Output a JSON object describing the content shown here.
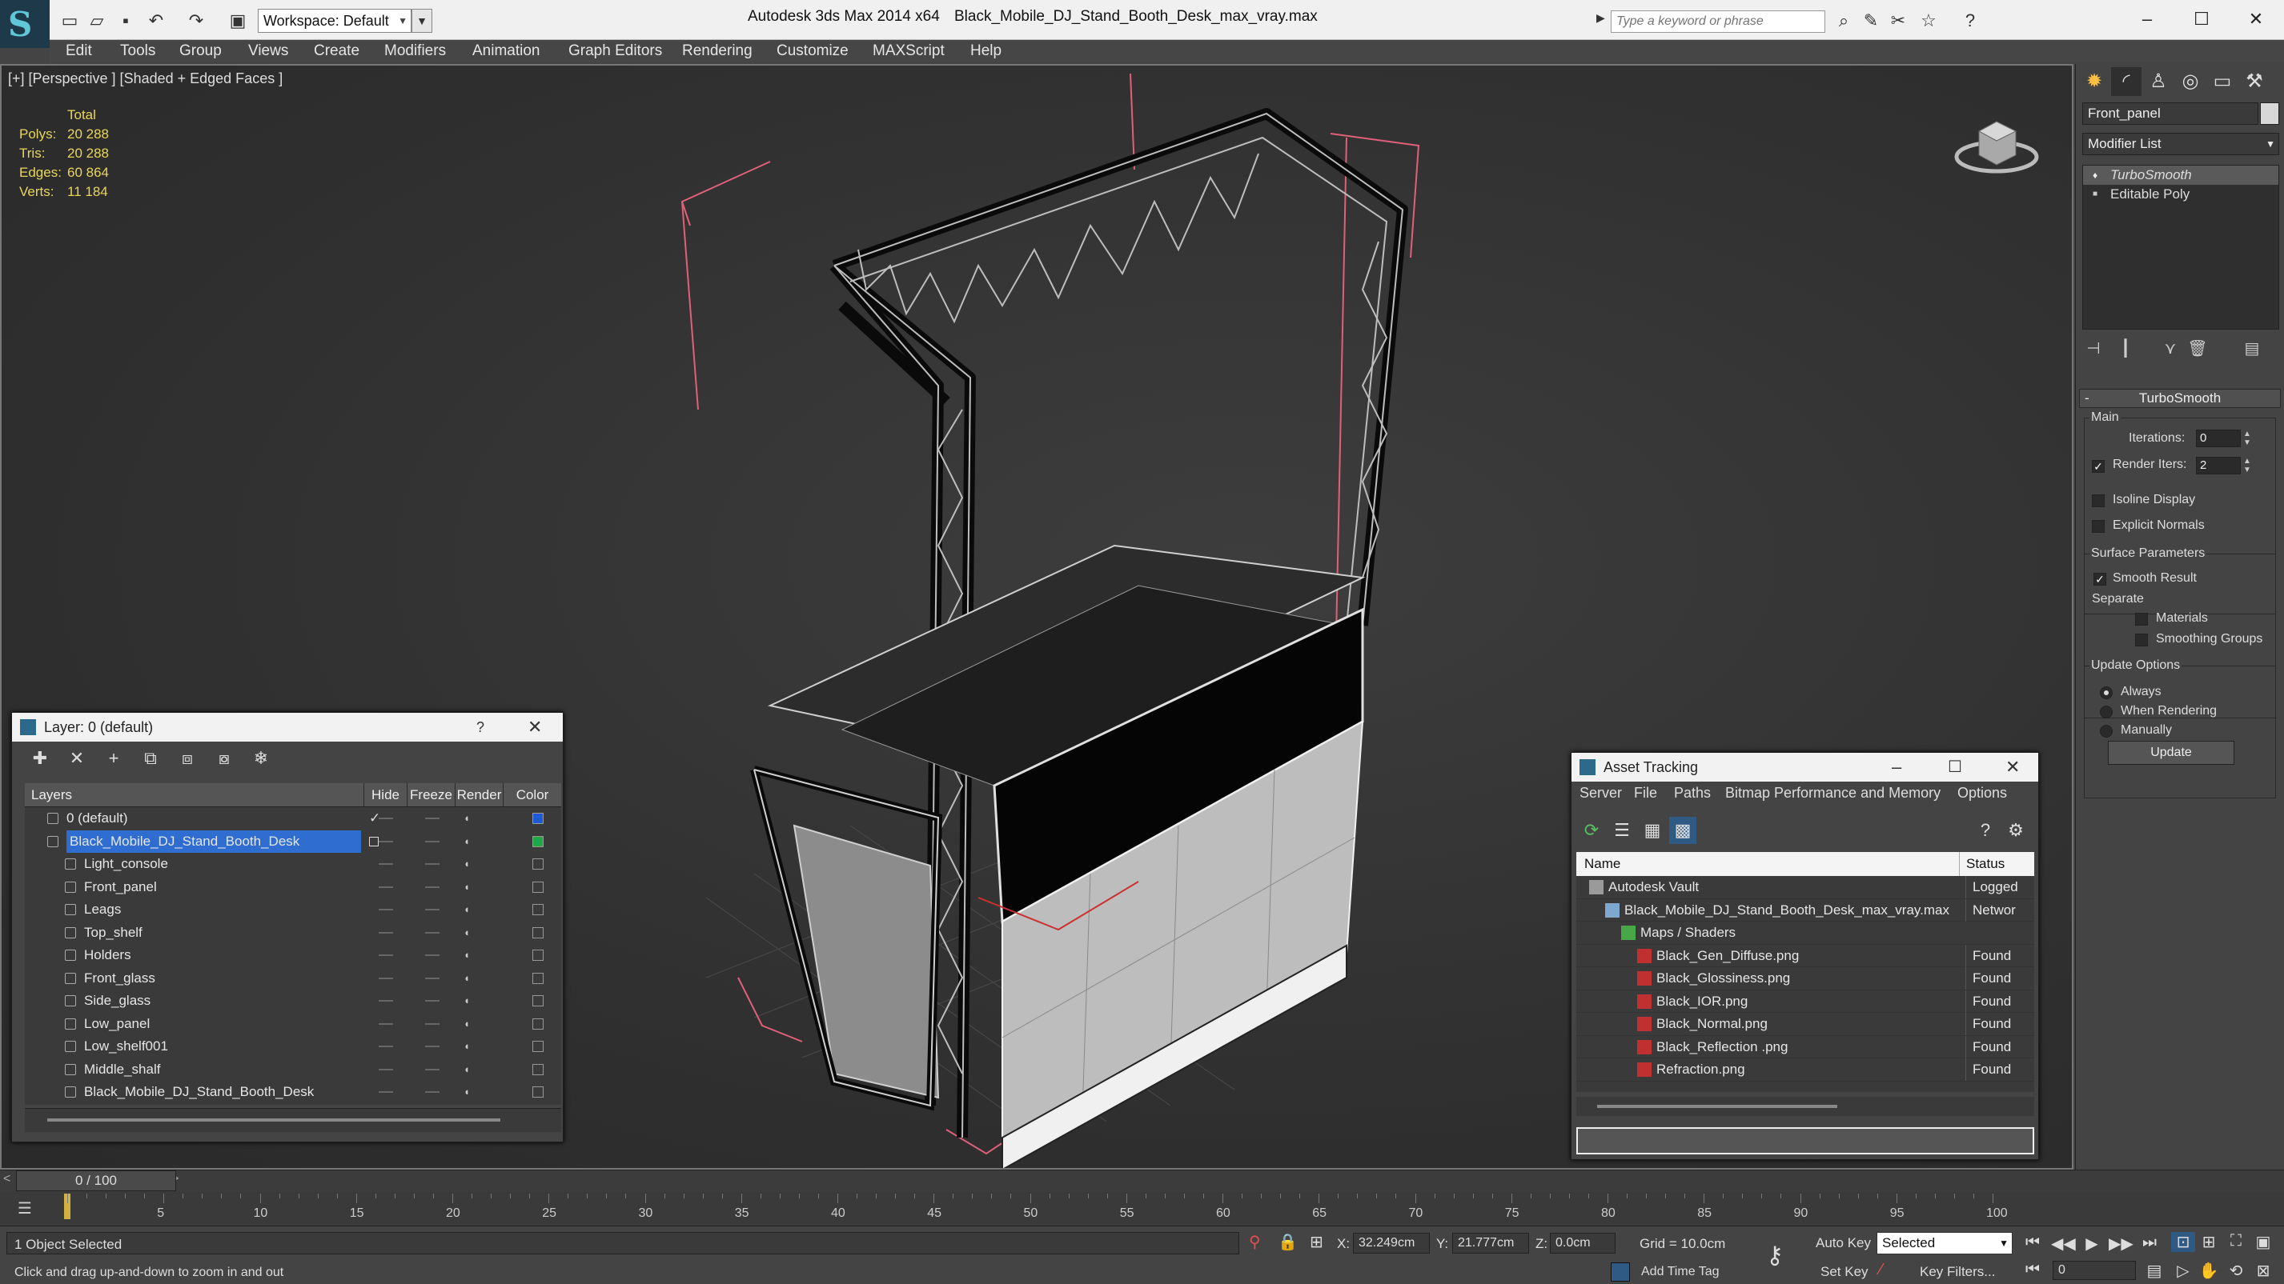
{
  "titlebar": {
    "workspace_label": "Workspace: Default",
    "app_title": "Autodesk 3ds Max  2014 x64",
    "file_title": "Black_Mobile_DJ_Stand_Booth_Desk_max_vray.max",
    "search_placeholder": "Type a keyword or phrase"
  },
  "menu": [
    "Edit",
    "Tools",
    "Group",
    "Views",
    "Create",
    "Modifiers",
    "Animation",
    "Graph Editors",
    "Rendering",
    "Customize",
    "MAXScript",
    "Help"
  ],
  "viewport": {
    "label": "[+] [Perspective ] [Shaded + Edged Faces ]",
    "stats": {
      "header": "Total",
      "polys_label": "Polys:",
      "polys": "20 288",
      "tris_label": "Tris:",
      "tris": "20 288",
      "edges_label": "Edges:",
      "edges": "60 864",
      "verts_label": "Verts:",
      "verts": "11 184"
    }
  },
  "command_panel": {
    "object_name": "Front_panel",
    "modifier_list": "Modifier List",
    "stack": [
      "TurboSmooth",
      "Editable Poly"
    ],
    "turbosmooth": {
      "title": "TurboSmooth",
      "main": "Main",
      "iterations_label": "Iterations:",
      "iterations": "0",
      "render_iters_label": "Render Iters:",
      "render_iters": "2",
      "isoline": "Isoline Display",
      "explicit": "Explicit Normals",
      "surface": "Surface Parameters",
      "smooth_result": "Smooth Result",
      "separate": "Separate",
      "materials": "Materials",
      "smoothing_groups": "Smoothing Groups",
      "update_options": "Update Options",
      "always": "Always",
      "when_rendering": "When Rendering",
      "manually": "Manually",
      "update_button": "Update"
    }
  },
  "layer_dialog": {
    "title": "Layer: 0 (default)",
    "help": "?",
    "columns": [
      "Layers",
      "Hide",
      "Freeze",
      "Render",
      "Color"
    ],
    "rows": [
      {
        "name": "0 (default)",
        "level": 1,
        "color": "#1e5bd6",
        "type": "layer"
      },
      {
        "name": "Black_Mobile_DJ_Stand_Booth_Desk",
        "level": 1,
        "color": "#1ea84a",
        "type": "layer",
        "selected": true
      },
      {
        "name": "Light_console",
        "level": 2,
        "color": "",
        "type": "object"
      },
      {
        "name": "Front_panel",
        "level": 2,
        "color": "",
        "type": "object"
      },
      {
        "name": "Leags",
        "level": 2,
        "color": "",
        "type": "object"
      },
      {
        "name": "Top_shelf",
        "level": 2,
        "color": "",
        "type": "object"
      },
      {
        "name": "Holders",
        "level": 2,
        "color": "",
        "type": "object"
      },
      {
        "name": "Front_glass",
        "level": 2,
        "color": "",
        "type": "object"
      },
      {
        "name": "Side_glass",
        "level": 2,
        "color": "",
        "type": "object"
      },
      {
        "name": "Low_panel",
        "level": 2,
        "color": "",
        "type": "object"
      },
      {
        "name": "Low_shelf001",
        "level": 2,
        "color": "",
        "type": "object"
      },
      {
        "name": "Middle_shalf",
        "level": 2,
        "color": "",
        "type": "object"
      },
      {
        "name": "Black_Mobile_DJ_Stand_Booth_Desk",
        "level": 2,
        "color": "",
        "type": "object"
      }
    ]
  },
  "asset_dialog": {
    "title": "Asset Tracking",
    "menu": [
      "Server",
      "File",
      "Paths",
      "Bitmap Performance and Memory",
      "Options"
    ],
    "columns": [
      "Name",
      "Status"
    ],
    "rows": [
      {
        "name": "Autodesk Vault",
        "status": "Logged",
        "level": 1
      },
      {
        "name": "Black_Mobile_DJ_Stand_Booth_Desk_max_vray.max",
        "status": "Networ",
        "level": 2
      },
      {
        "name": "Maps / Shaders",
        "status": "",
        "level": 3
      },
      {
        "name": "Black_Gen_Diffuse.png",
        "status": "Found",
        "level": 4
      },
      {
        "name": "Black_Glossiness.png",
        "status": "Found",
        "level": 4
      },
      {
        "name": "Black_IOR.png",
        "status": "Found",
        "level": 4
      },
      {
        "name": "Black_Normal.png",
        "status": "Found",
        "level": 4
      },
      {
        "name": "Black_Reflection .png",
        "status": "Found",
        "level": 4
      },
      {
        "name": "Refraction.png",
        "status": "Found",
        "level": 4
      }
    ]
  },
  "timeline": {
    "frame": "0 / 100",
    "ticks": [
      "5",
      "10",
      "15",
      "20",
      "25",
      "30",
      "35",
      "40",
      "45",
      "50",
      "55",
      "60",
      "65",
      "70",
      "75",
      "80",
      "85",
      "90",
      "95",
      "100"
    ]
  },
  "status": {
    "selection": "1 Object Selected",
    "prompt": "Click and drag up-and-down to zoom in and out",
    "x_label": "X:",
    "x": "32.249cm",
    "y_label": "Y:",
    "y": "21.777cm",
    "z_label": "Z:",
    "z": "0.0cm",
    "grid": "Grid = 10.0cm",
    "add_time_tag": "Add Time Tag",
    "auto_key": "Auto Key",
    "set_key": "Set Key",
    "selected": "Selected",
    "key_filters": "Key Filters...",
    "frame_value": "0"
  }
}
